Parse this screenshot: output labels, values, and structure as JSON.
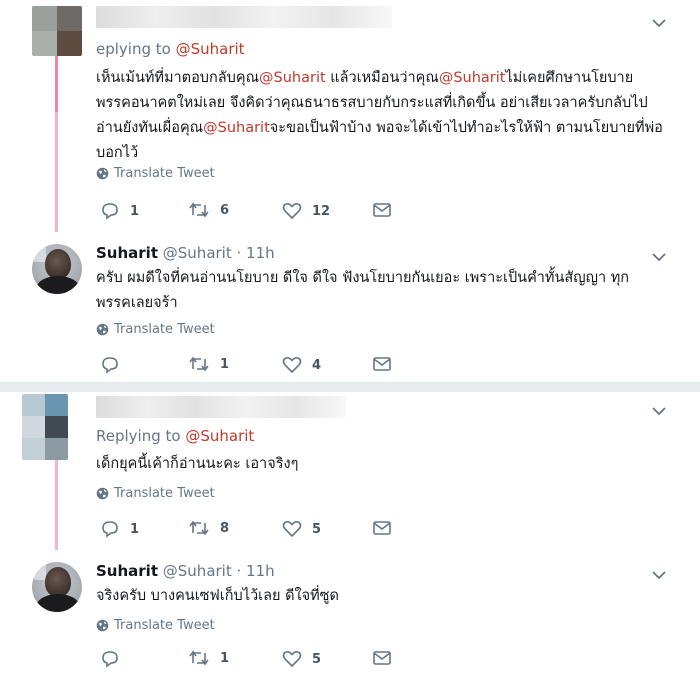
{
  "tweets": [
    {
      "reply_prefix": "eplying to ",
      "reply_to": "@Suharit",
      "text_parts": [
        "เห็นเม้นท์ที่มาตอบกลับคุณ",
        "@Suharit",
        " แล้วเหมือนว่าคุณ",
        "@Suharit",
        "ไม่เคยศึกษานโยบาย พรรคอนาคตใหม่เลย จึงคิดว่าคุณธนาธรสบายกับกระแสที่เกิดขึ้น อย่าเสียเวลาครับกลับไป อ่านยังทันเผื่อคุณ",
        "@Suharit",
        "จะขอเป็นฟ้าบ้าง พอจะได้เข้าไปทำอะไรให้ฟ้า ตามนโยบายที่พ่อบอกไว้"
      ],
      "translate": "Translate Tweet",
      "replies": "1",
      "retweets": "6",
      "likes": "12"
    },
    {
      "name": "Suharit",
      "handle": "@Suharit · 11h",
      "text": "ครับ ผมดีใจที่คนอ่านนโยบาย ดีใจ ดีใจ ฟังนโยบายกันเยอะ เพราะเป็นคำทั้นสัญญา ทุก พรรคเลยจร้า",
      "translate": "Translate Tweet",
      "replies": "",
      "retweets": "1",
      "likes": "4"
    },
    {
      "reply_prefix": "Replying to ",
      "reply_to": "@Suharit",
      "text": "เด็กยุคนี้เค้าก็อ่านนะคะ เอาจริงๆ",
      "translate": "Translate Tweet",
      "replies": "1",
      "retweets": "8",
      "likes": "5"
    },
    {
      "name": "Suharit",
      "handle": "@Suharit · 11h",
      "text": "จริงครับ บางคนเซฟเก็บไว้เลย ดีใจที่ซูด",
      "translate": "Translate Tweet",
      "replies": "",
      "retweets": "1",
      "likes": "5"
    }
  ],
  "colors": {
    "mention": "#c0392b",
    "thread_line": "#e0245e",
    "muted": "#657786"
  }
}
